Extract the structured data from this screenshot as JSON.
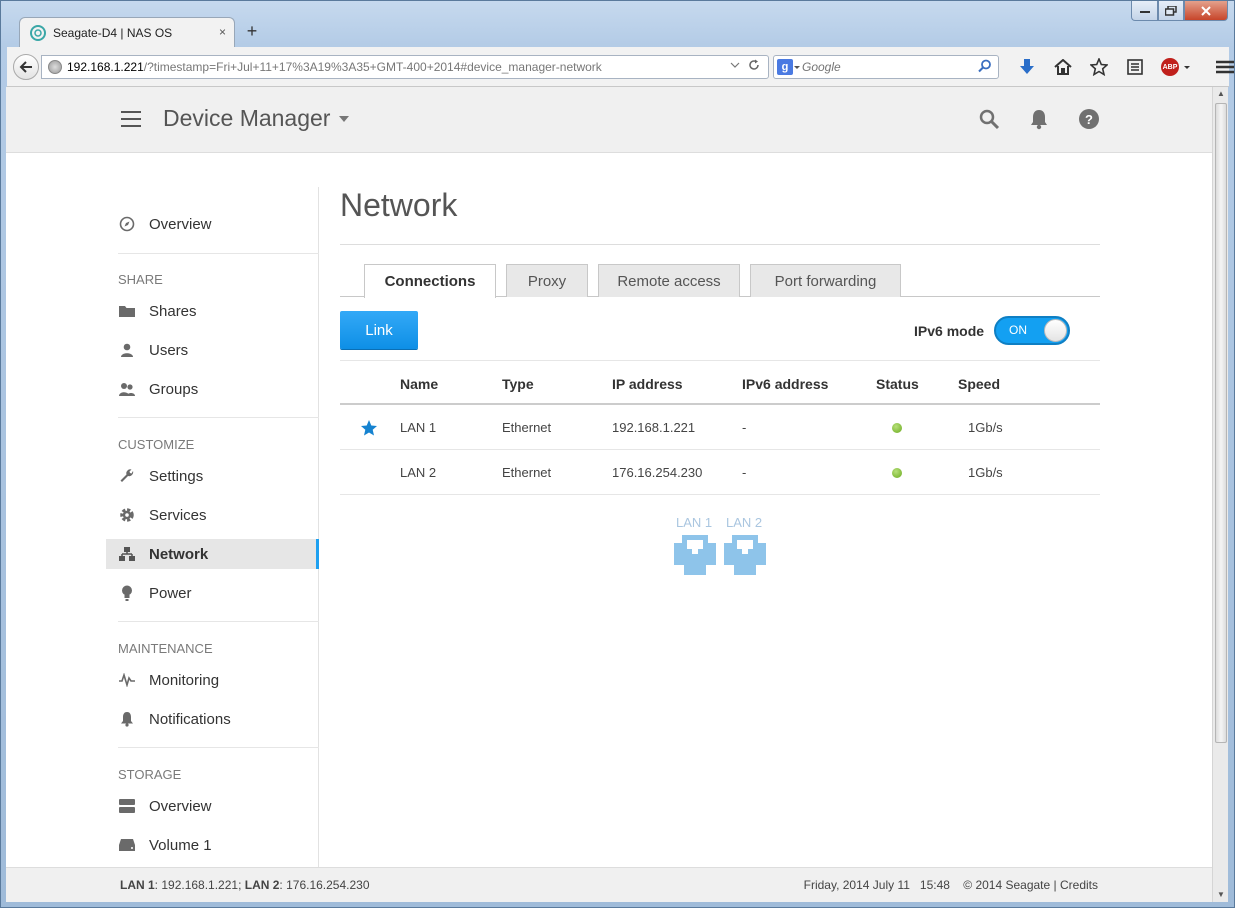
{
  "browser": {
    "tab_title": "Seagate-D4 | NAS OS",
    "tab_close": "×",
    "new_tab": "+",
    "url_host": "192.168.1.221",
    "url_path": "/?timestamp=Fri+Jul+11+17%3A19%3A35+GMT-400+2014#device_manager-network",
    "search_placeholder": "Google",
    "search_engine": "g"
  },
  "header": {
    "title": "Device Manager"
  },
  "sidebar": {
    "overview": "Overview",
    "share_section": "SHARE",
    "shares": "Shares",
    "users": "Users",
    "groups": "Groups",
    "customize_section": "CUSTOMIZE",
    "settings": "Settings",
    "services": "Services",
    "network": "Network",
    "power": "Power",
    "maintenance_section": "MAINTENANCE",
    "monitoring": "Monitoring",
    "notifications": "Notifications",
    "storage_section": "STORAGE",
    "storage_overview": "Overview",
    "volume1": "Volume 1"
  },
  "main": {
    "title": "Network",
    "tabs": [
      "Connections",
      "Proxy",
      "Remote access",
      "Port forwarding"
    ],
    "link_button": "Link",
    "ipv6_label": "IPv6 mode",
    "ipv6_toggle": "ON",
    "table": {
      "headers": [
        "Name",
        "Type",
        "IP address",
        "IPv6 address",
        "Status",
        "Speed"
      ],
      "rows": [
        {
          "name": "LAN 1",
          "type": "Ethernet",
          "ip": "192.168.1.221",
          "ipv6": "-",
          "speed": "1Gb/s",
          "primary": true
        },
        {
          "name": "LAN 2",
          "type": "Ethernet",
          "ip": "176.16.254.230",
          "ipv6": "-",
          "speed": "1Gb/s",
          "primary": false
        }
      ]
    },
    "ports": [
      "LAN 1",
      "LAN 2"
    ]
  },
  "footer": {
    "lan1_label": "LAN 1",
    "lan1_value": ": 192.168.1.221; ",
    "lan2_label": "LAN 2",
    "lan2_value": ": 176.16.254.230",
    "datetime": "Friday, 2014 July 11   15:48",
    "copyright": "© 2014 Seagate | Credits"
  },
  "colors": {
    "accent": "#13a0f2",
    "status_ok": "#6aaa1e",
    "port": "#8ec4ea"
  }
}
